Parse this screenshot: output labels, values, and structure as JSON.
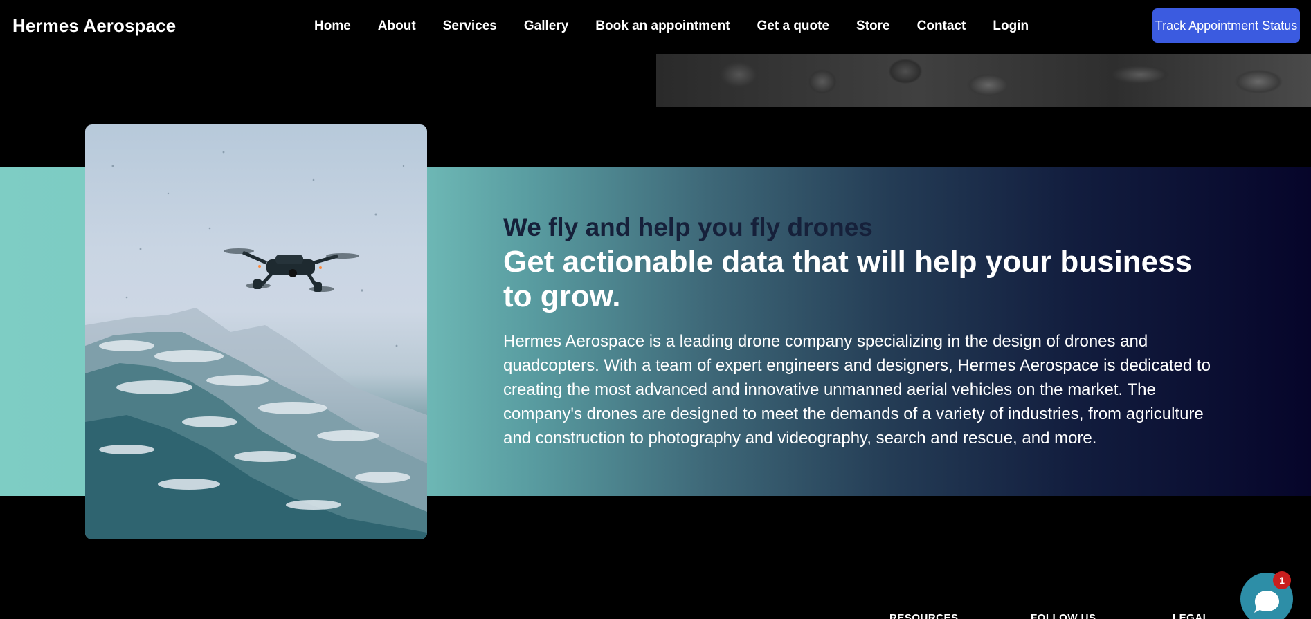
{
  "brand": "Hermes Aerospace",
  "nav": {
    "items": [
      {
        "label": "Home"
      },
      {
        "label": "About"
      },
      {
        "label": "Services"
      },
      {
        "label": "Gallery"
      },
      {
        "label": "Book an appointment"
      },
      {
        "label": "Get a quote"
      },
      {
        "label": "Store"
      },
      {
        "label": "Contact"
      },
      {
        "label": "Login"
      }
    ],
    "cta_label": "Track Appointment Status",
    "cta_color": "#3b5be0"
  },
  "hero": {
    "subheading": "We fly and help you fly drones",
    "headline": "Get actionable data that will help your business to grow.",
    "body": "Hermes Aerospace is a leading drone company specializing in the design of drones and quadcopters. With a team of expert engineers and designers, Hermes Aerospace is dedicated to creating the most advanced and innovative unmanned aerial vehicles on the market. The company's drones are designed to meet the demands of a variety of industries, from agriculture and construction to photography and videography, search and rescue, and more."
  },
  "footer": {
    "headings": [
      "RESOURCES",
      "FOLLOW US",
      "LEGAL"
    ]
  },
  "chat": {
    "badge_count": "1",
    "icon": "chat-bubble-icon"
  }
}
